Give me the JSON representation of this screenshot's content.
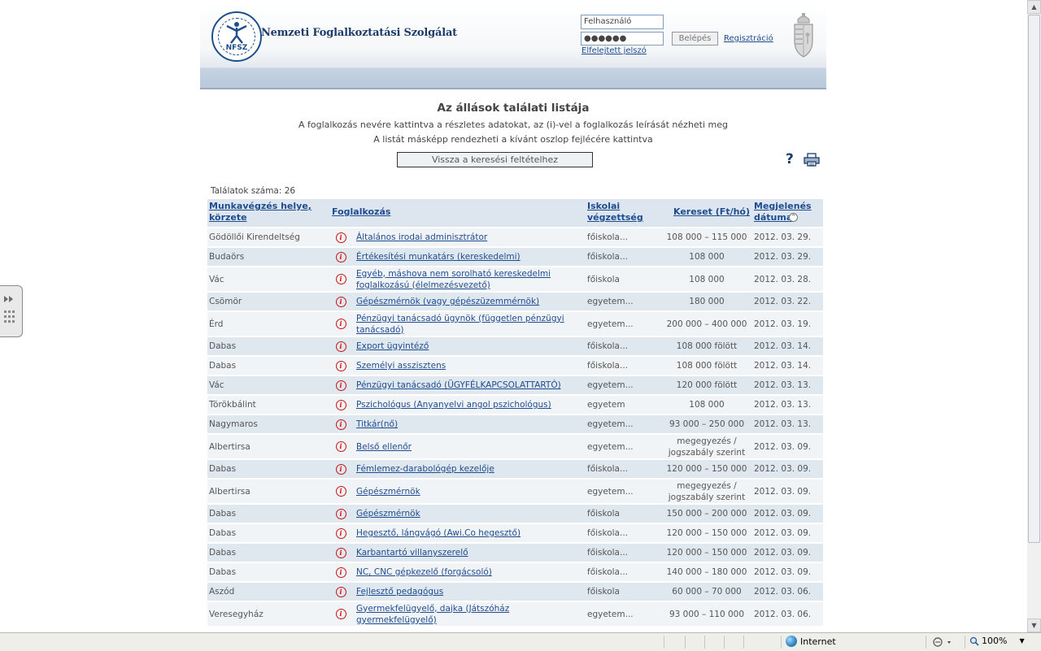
{
  "header": {
    "org_abbr": "NFSZ",
    "org_name": "Nemzeti Foglalkoztatási Szolgálat",
    "username_placeholder": "Felhasználó",
    "password_mask": "●●●●●●",
    "login_label": "Belépés",
    "register_label": "Regisztráció",
    "forgot_label": "Elfelejtett jelszó"
  },
  "content": {
    "title": "Az állások találati listája",
    "subtitle1": "A foglalkozás nevére kattintva a részletes adatokat, az (i)-vel a foglalkozás leírását nézheti meg",
    "subtitle2": "A listát másképp rendezheti a kívánt oszlop fejlécére kattintva",
    "back_label": "Vissza a keresési feltételhez",
    "help_label": "?",
    "result_count": "Találatok száma: 26"
  },
  "table": {
    "headers": {
      "location": "Munkavégzés helye, körzete",
      "job": "Foglalkozás",
      "education": "Iskolai végzettség",
      "pay": "Kereset (Ft/hó)",
      "date": "Megjelenés dátuma"
    },
    "rows": [
      {
        "location": "Gödöllői Kirendeltség",
        "job": "Általános irodai adminisztrátor",
        "education": "főiskola...",
        "pay": "108 000 – 115 000",
        "date": "2012. 03. 29."
      },
      {
        "location": "Budaörs",
        "job": "Értékesítési munkatárs (kereskedelmi)",
        "education": "főiskola...",
        "pay": "108 000",
        "date": "2012. 03. 29."
      },
      {
        "location": "Vác",
        "job": "Egyéb, máshova nem sorolható kereskedelmi foglalkozású (élelmezésvezető)",
        "education": "főiskola",
        "pay": "108 000",
        "date": "2012. 03. 28."
      },
      {
        "location": "Csömör",
        "job": "Gépészmérnök (vagy gépészüzemmérnök)",
        "education": "egyetem...",
        "pay": "180 000",
        "date": "2012. 03. 22."
      },
      {
        "location": "Érd",
        "job": "Pénzügyi tanácsadó ügynök (független pénzügyi tanácsadó)",
        "education": "egyetem...",
        "pay": "200 000 – 400 000",
        "date": "2012. 03. 19."
      },
      {
        "location": "Dabas",
        "job": "Export ügyintéző",
        "education": "főiskola...",
        "pay": "108 000 fölött",
        "date": "2012. 03. 14."
      },
      {
        "location": "Dabas",
        "job": "Személyi asszisztens",
        "education": "főiskola...",
        "pay": "108 000 fölött",
        "date": "2012. 03. 14."
      },
      {
        "location": "Vác",
        "job": "Pénzügyi tanácsadó (ÜGYFÉLKAPCSOLATTARTÓ)",
        "education": "egyetem...",
        "pay": "120 000 fölött",
        "date": "2012. 03. 13."
      },
      {
        "location": "Törökbálint",
        "job": "Pszichológus (Anyanyelvi angol pszichológus)",
        "education": "egyetem",
        "pay": "108 000",
        "date": "2012. 03. 13."
      },
      {
        "location": "Nagymaros",
        "job": "Titkár(nő)",
        "education": "egyetem...",
        "pay": "93 000 – 250 000",
        "date": "2012. 03. 13."
      },
      {
        "location": "Albertirsa",
        "job": "Belső ellenőr",
        "education": "egyetem...",
        "pay": "megegyezés / jogszabály szerint",
        "date": "2012. 03. 09."
      },
      {
        "location": "Dabas",
        "job": "Fémlemez-darabológép kezelője",
        "education": "főiskola...",
        "pay": "120 000 – 150 000",
        "date": "2012. 03. 09."
      },
      {
        "location": "Albertirsa",
        "job": "Gépészmérnök",
        "education": "egyetem...",
        "pay": "megegyezés / jogszabály szerint",
        "date": "2012. 03. 09."
      },
      {
        "location": "Dabas",
        "job": "Gépészmérnök",
        "education": "főiskola",
        "pay": "150 000 – 200 000",
        "date": "2012. 03. 09."
      },
      {
        "location": "Dabas",
        "job": "Hegesztő, lángvágó (Awi.Co hegesztő)",
        "education": "főiskola...",
        "pay": "120 000 – 150 000",
        "date": "2012. 03. 09."
      },
      {
        "location": "Dabas",
        "job": "Karbantartó villanyszerelő",
        "education": "főiskola...",
        "pay": "120 000 – 150 000",
        "date": "2012. 03. 09."
      },
      {
        "location": "Dabas",
        "job": "NC, CNC gépkezelő (forgácsoló)",
        "education": "főiskola...",
        "pay": "140 000 – 180 000",
        "date": "2012. 03. 09."
      },
      {
        "location": "Aszód",
        "job": "Fejlesztő pedagógus",
        "education": "főiskola",
        "pay": "60 000 – 70 000",
        "date": "2012. 03. 06."
      },
      {
        "location": "Veresegyház",
        "job": "Gyermekfelügyelő, dajka (Játszóház gyermekfelügyelő)",
        "education": "egyetem...",
        "pay": "93 000 – 110 000",
        "date": "2012. 03. 06."
      }
    ]
  },
  "statusbar": {
    "zone": "Internet",
    "zoom": "100%"
  }
}
